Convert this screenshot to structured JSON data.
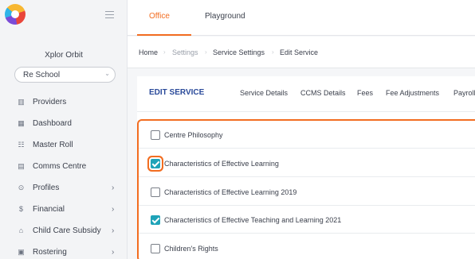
{
  "sidebar": {
    "org_name": "Xplor Orbit",
    "school_select": "Re School",
    "items": [
      {
        "label": "Providers",
        "icon": "providers-icon",
        "glyph": "▥",
        "arrow": ""
      },
      {
        "label": "Dashboard",
        "icon": "dashboard-icon",
        "glyph": "▦",
        "arrow": ""
      },
      {
        "label": "Master Roll",
        "icon": "master-roll-icon",
        "glyph": "☷",
        "arrow": ""
      },
      {
        "label": "Comms Centre",
        "icon": "comms-icon",
        "glyph": "▤",
        "arrow": ""
      },
      {
        "label": "Profiles",
        "icon": "profiles-icon",
        "glyph": "⊙",
        "arrow": "›"
      },
      {
        "label": "Financial",
        "icon": "financial-icon",
        "glyph": "$",
        "arrow": "›"
      },
      {
        "label": "Child Care Subsidy",
        "icon": "subsidy-icon",
        "glyph": "⌂",
        "arrow": "›"
      },
      {
        "label": "Rostering",
        "icon": "rostering-icon",
        "glyph": "▣",
        "arrow": "›"
      }
    ]
  },
  "topbar": {
    "tabs": [
      "Office",
      "Playground"
    ]
  },
  "breadcrumb": {
    "home": "Home",
    "settings": "Settings",
    "service_settings": "Service Settings",
    "current": "Edit Service",
    "sep": "›"
  },
  "card": {
    "title": "EDIT SERVICE",
    "tabs": [
      "Service Details",
      "CCMS Details",
      "Fees",
      "Fee Adjustments",
      "Payroll"
    ]
  },
  "checklist": [
    {
      "label": "Centre Philosophy",
      "checked": false,
      "focus": false
    },
    {
      "label": "Characteristics of Effective Learning",
      "checked": true,
      "focus": true
    },
    {
      "label": "Characteristics of Effective Learning 2019",
      "checked": false,
      "focus": false
    },
    {
      "label": "Characteristics of Effective Teaching and Learning 2021",
      "checked": true,
      "focus": false
    },
    {
      "label": "Children's Rights",
      "checked": false,
      "focus": false
    }
  ],
  "colors": {
    "accent": "#f26d21",
    "checkbox": "#1fa3b8",
    "title": "#2a4a9a"
  }
}
